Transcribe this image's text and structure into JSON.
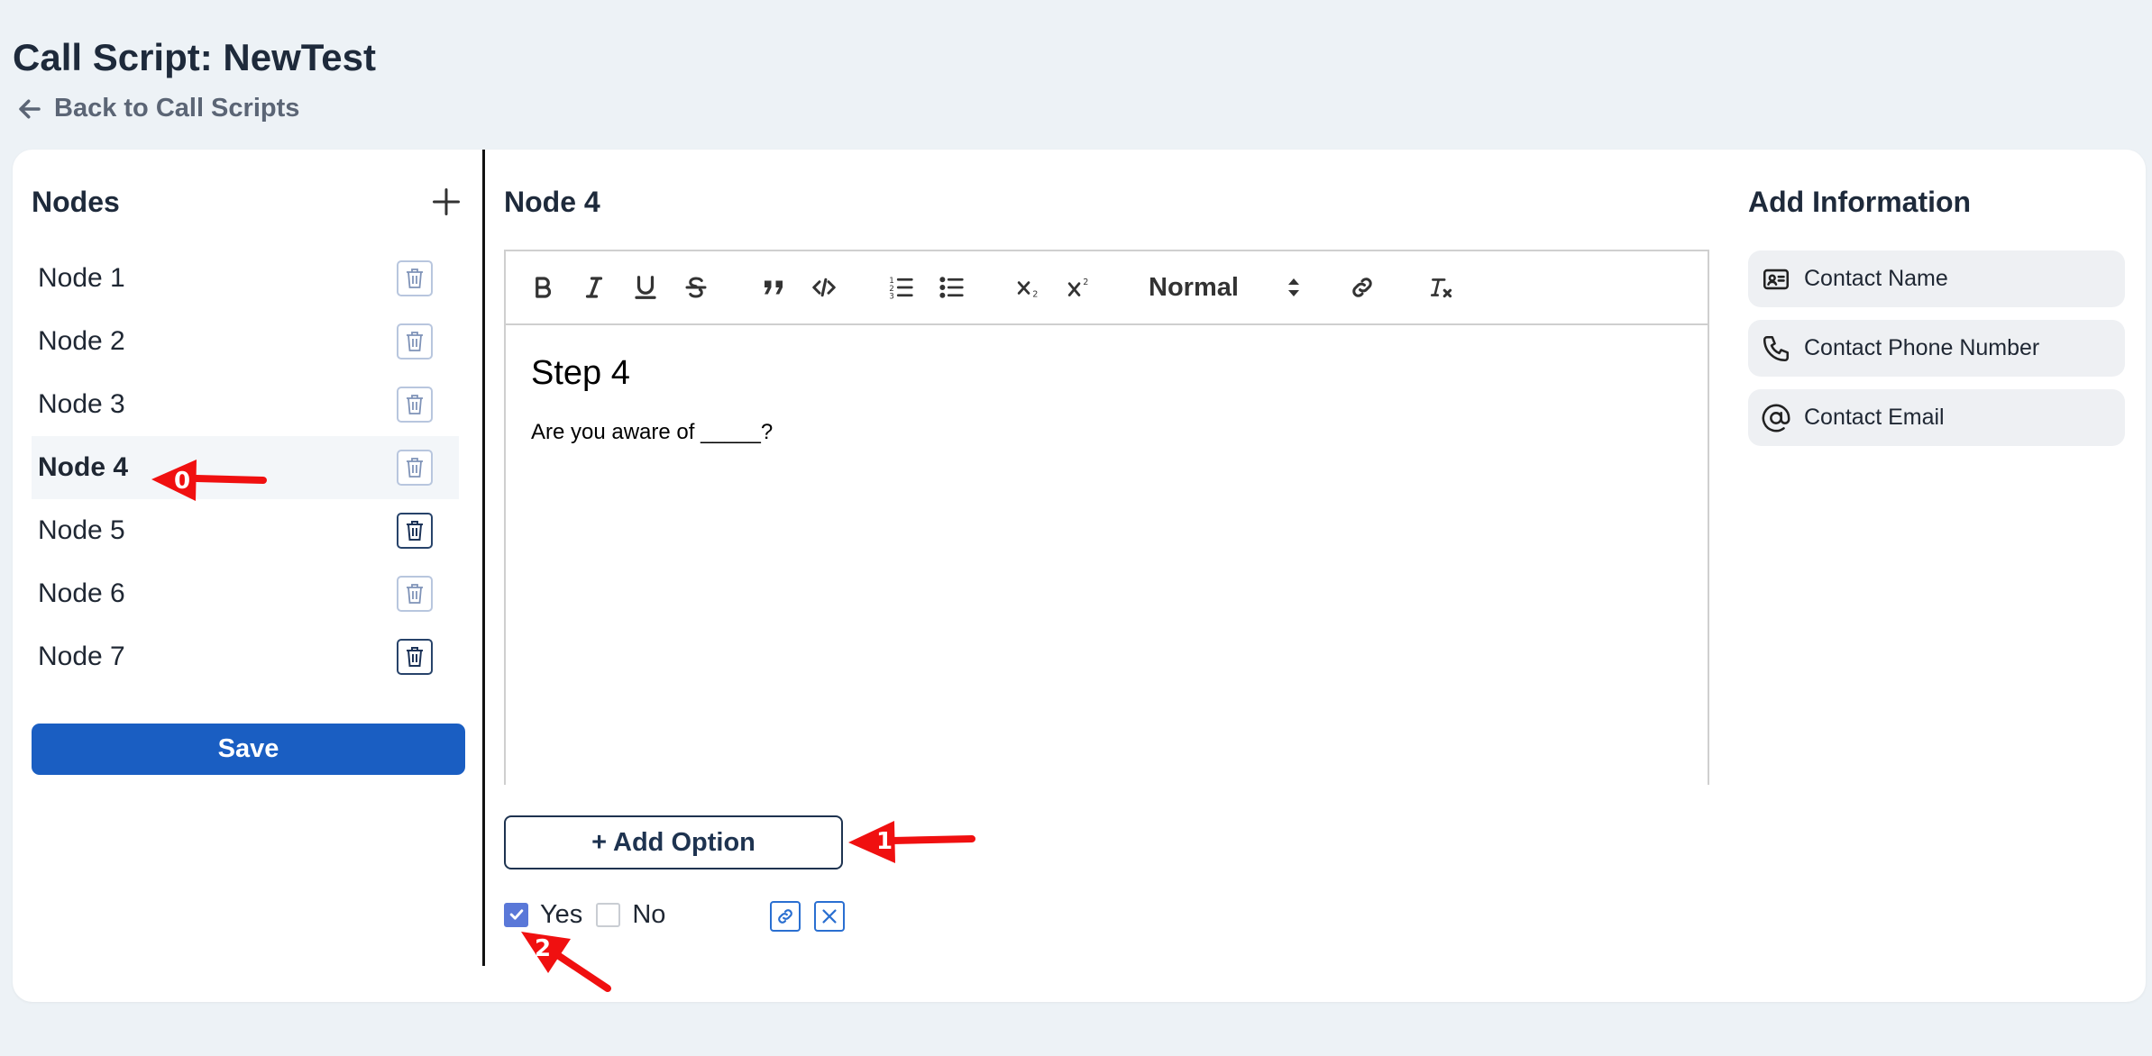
{
  "header": {
    "title": "Call Script: NewTest",
    "back_label": "Back to Call Scripts"
  },
  "nodes": {
    "title": "Nodes",
    "add_icon": "plus-icon",
    "items": [
      {
        "label": "Node 1",
        "active": false
      },
      {
        "label": "Node 2",
        "active": false
      },
      {
        "label": "Node 3",
        "active": false
      },
      {
        "label": "Node 4",
        "active": true
      },
      {
        "label": "Node 5",
        "active": false
      },
      {
        "label": "Node 6",
        "active": false
      },
      {
        "label": "Node 7",
        "active": false
      }
    ],
    "save_label": "Save"
  },
  "editor": {
    "title": "Node 4",
    "heading_select": "Normal",
    "content_heading": "Step 4",
    "content_body": "Are you aware of _____?",
    "add_option_label": "+ Add Option",
    "options": [
      {
        "label": "Yes",
        "checked": true
      },
      {
        "label": "No",
        "checked": false
      }
    ]
  },
  "info": {
    "title": "Add Information",
    "items": [
      {
        "label": "Contact Name",
        "icon": "contact-card-icon"
      },
      {
        "label": "Contact Phone Number",
        "icon": "phone-icon"
      },
      {
        "label": "Contact Email",
        "icon": "at-sign-icon"
      }
    ]
  },
  "annotations": [
    "0",
    "1",
    "2"
  ],
  "colors": {
    "primary": "#1a5ec2",
    "checkbox": "#5a78d8",
    "annotation": "#f01010"
  }
}
